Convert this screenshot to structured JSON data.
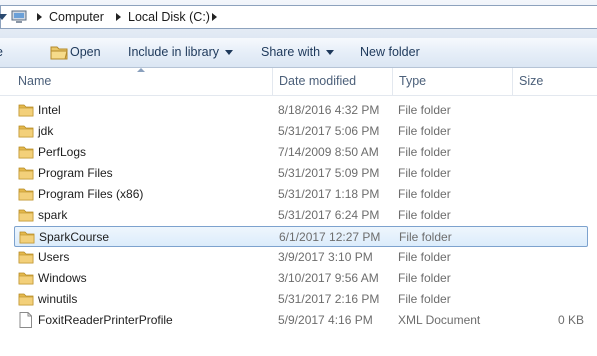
{
  "address": {
    "crumbs": [
      "Computer",
      "Local Disk (C:)"
    ]
  },
  "toolbar": {
    "open_label": "Open",
    "include_label": "Include in library",
    "share_label": "Share with",
    "newfolder_label": "New folder"
  },
  "columns": {
    "name": "Name",
    "date": "Date modified",
    "type": "Type",
    "size": "Size"
  },
  "files": [
    {
      "name": "Intel",
      "date": "8/18/2016 4:32 PM",
      "type": "File folder",
      "size": "",
      "icon": "folder-icon"
    },
    {
      "name": "jdk",
      "date": "5/31/2017 5:06 PM",
      "type": "File folder",
      "size": "",
      "icon": "folder-icon"
    },
    {
      "name": "PerfLogs",
      "date": "7/14/2009 8:50 AM",
      "type": "File folder",
      "size": "",
      "icon": "folder-icon"
    },
    {
      "name": "Program Files",
      "date": "5/31/2017 5:09 PM",
      "type": "File folder",
      "size": "",
      "icon": "folder-icon"
    },
    {
      "name": "Program Files (x86)",
      "date": "5/31/2017 1:18 PM",
      "type": "File folder",
      "size": "",
      "icon": "folder-icon"
    },
    {
      "name": "spark",
      "date": "5/31/2017 6:24 PM",
      "type": "File folder",
      "size": "",
      "icon": "folder-icon"
    },
    {
      "name": "SparkCourse",
      "date": "6/1/2017 12:27 PM",
      "type": "File folder",
      "size": "",
      "icon": "folder-icon",
      "selected": true
    },
    {
      "name": "Users",
      "date": "3/9/2017 3:10 PM",
      "type": "File folder",
      "size": "",
      "icon": "folder-icon"
    },
    {
      "name": "Windows",
      "date": "3/10/2017 9:56 AM",
      "type": "File folder",
      "size": "",
      "icon": "folder-icon"
    },
    {
      "name": "winutils",
      "date": "5/31/2017 2:16 PM",
      "type": "File folder",
      "size": "",
      "icon": "folder-icon"
    },
    {
      "name": "FoxitReaderPrinterProfile",
      "date": "5/9/2017 4:16 PM",
      "type": "XML Document",
      "size": "0 KB",
      "icon": "document-icon"
    }
  ]
}
